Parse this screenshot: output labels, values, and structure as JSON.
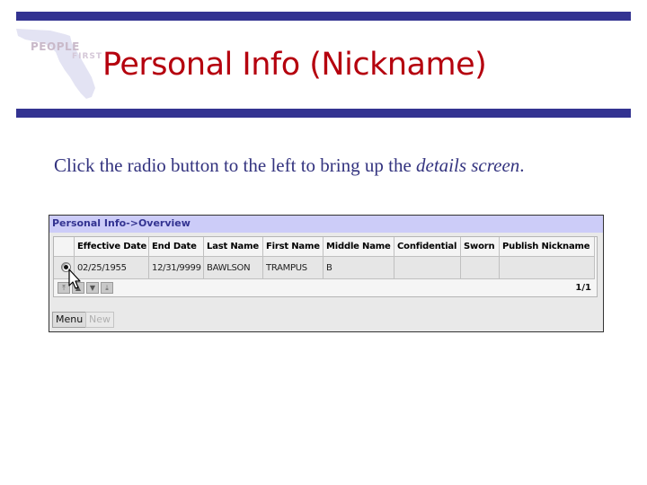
{
  "header": {
    "logo_line1": "PEOPLE",
    "logo_line2": "FIRST",
    "title": "Personal Info (Nickname)"
  },
  "instruction": {
    "prefix": "Click the radio button to the left to bring up the ",
    "emphasis": "details screen",
    "suffix": "."
  },
  "panel": {
    "title": "Personal Info->Overview",
    "columns": [
      "Effective Date",
      "End Date",
      "Last Name",
      "First Name",
      "Middle Name",
      "Confidential",
      "Sworn",
      "Publish Nickname"
    ],
    "rows": [
      {
        "selected": true,
        "effective_date": "02/25/1955",
        "end_date": "12/31/9999",
        "last_name": "BAWLSON",
        "first_name": "TRAMPUS",
        "middle_name": "B",
        "confidential": "",
        "sworn": "",
        "publish_nickname": ""
      }
    ],
    "nav_icons": [
      "first-page-icon",
      "previous-page-icon",
      "next-page-icon",
      "last-page-icon"
    ],
    "page_count": "1/1",
    "buttons": {
      "menu": "Menu",
      "new": "New"
    }
  },
  "colors": {
    "bar": "#333391",
    "title": "#b5000e",
    "instruction": "#33337f",
    "panel_header_bg": "#ccccf8"
  }
}
